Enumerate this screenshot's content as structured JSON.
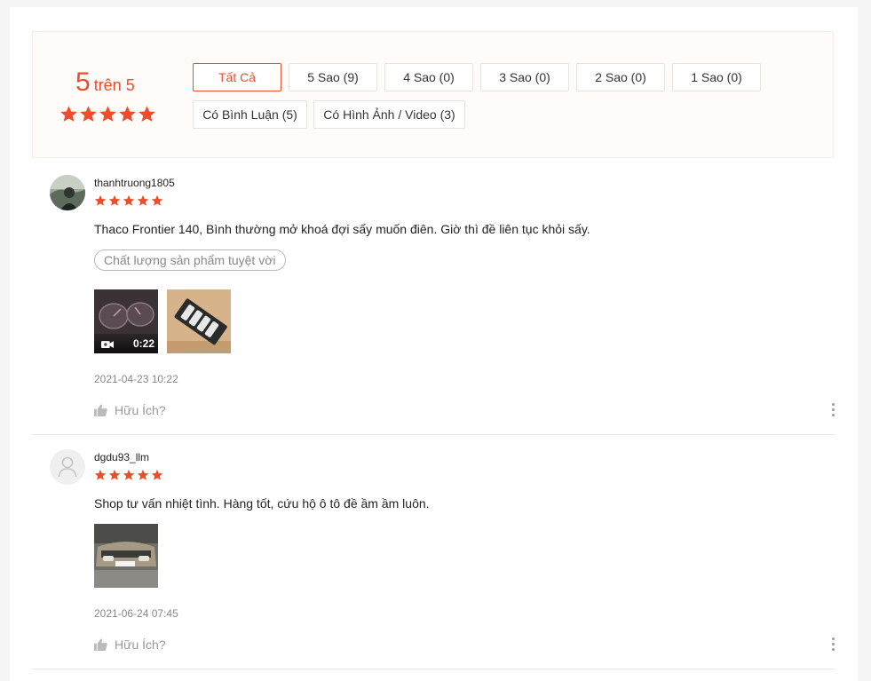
{
  "summary": {
    "score": "5",
    "out_of": "trên 5",
    "stars": 5,
    "accent": "#ee4d2d",
    "filters": [
      {
        "label": "Tất Cả",
        "active": true
      },
      {
        "label": "5 Sao (9)"
      },
      {
        "label": "4 Sao (0)"
      },
      {
        "label": "3 Sao (0)"
      },
      {
        "label": "2 Sao (0)"
      },
      {
        "label": "1 Sao (0)"
      },
      {
        "label": "Có Bình Luận (5)"
      },
      {
        "label": "Có Hình Ảnh / Video (3)"
      }
    ]
  },
  "reviews": [
    {
      "username": "thanhtruong1805",
      "rating": 5,
      "comment": "Thaco Frontier 140, Bình thường mở khoá đợi sấy muốn điên. Giờ thì đề liên tục khỏi sấy.",
      "tag": "Chất lượng sản phẩm tuyệt vời",
      "media": [
        {
          "type": "video",
          "duration": "0:22",
          "icon": "video-camera-icon"
        },
        {
          "type": "image"
        }
      ],
      "date": "2021-04-23 10:22",
      "helpful": "Hữu Ích?"
    },
    {
      "username": "dgdu93_llm",
      "rating": 5,
      "comment": "Shop tư vấn nhiệt tình. Hàng tốt, cứu hộ ô tô đề ầm ầm luôn.",
      "media": [
        {
          "type": "image"
        }
      ],
      "date": "2021-06-24 07:45",
      "helpful": "Hữu Ích?"
    }
  ]
}
